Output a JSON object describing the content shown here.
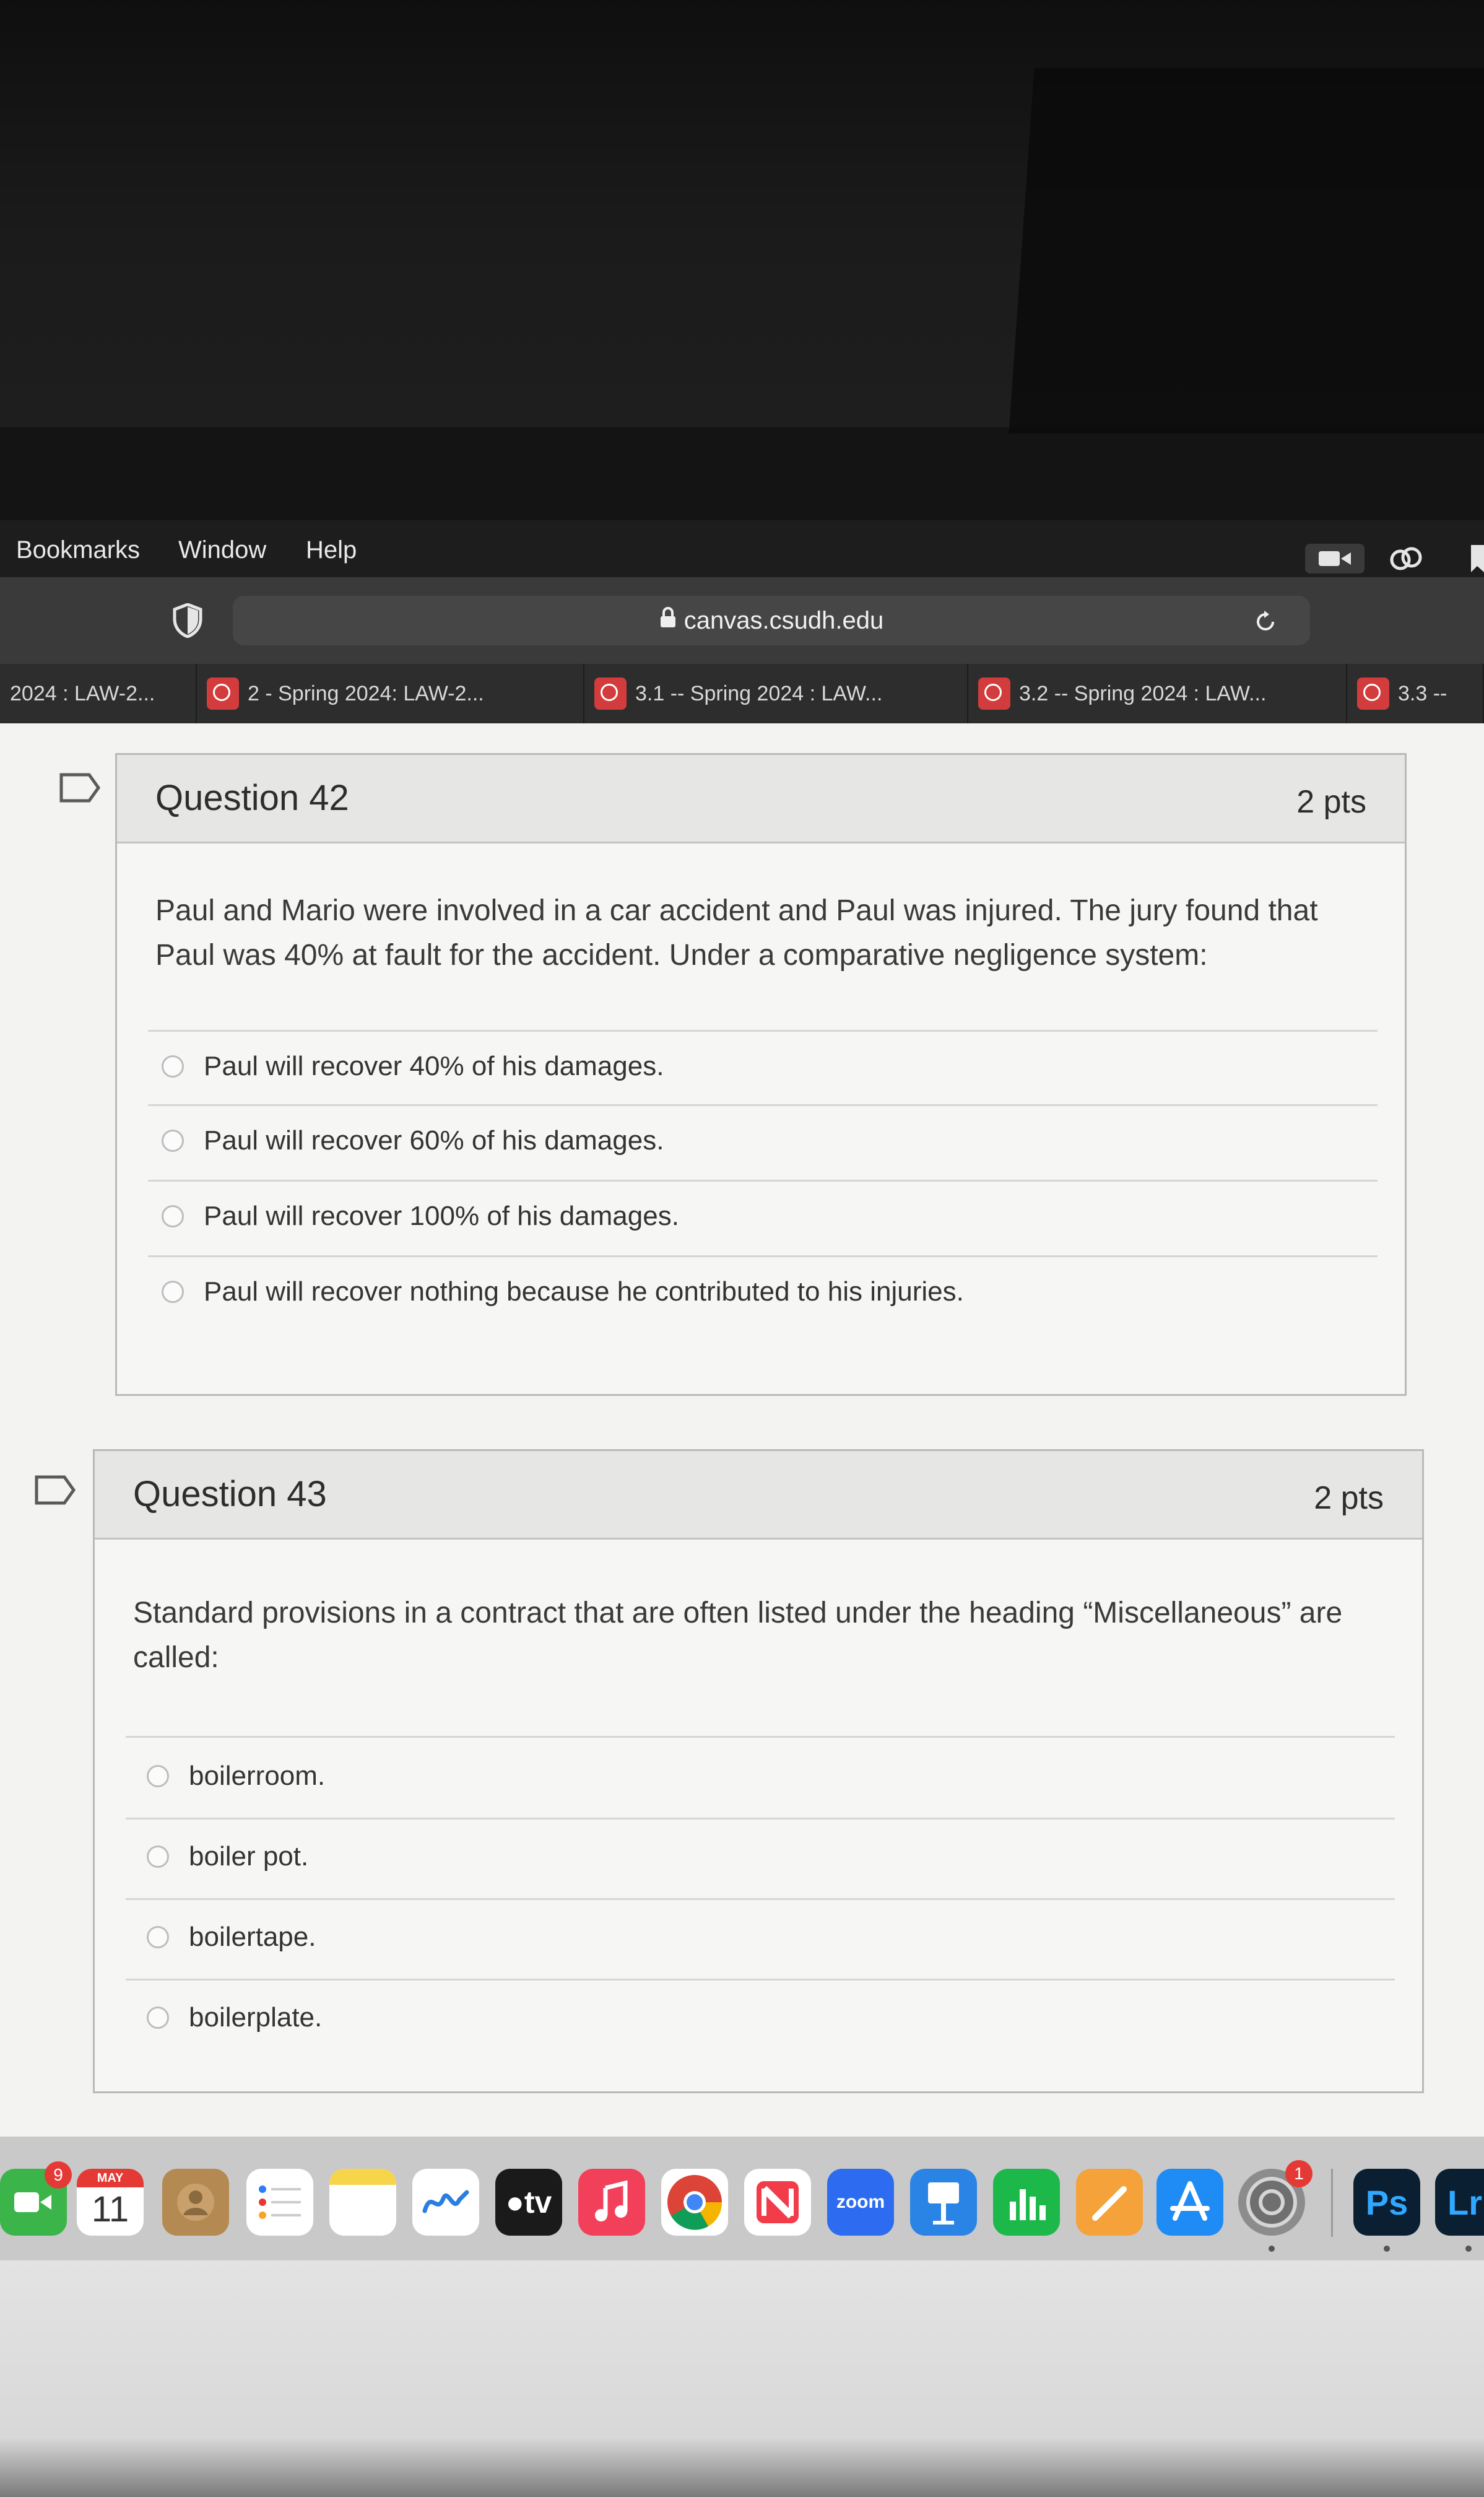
{
  "menubar": {
    "items": [
      "Bookmarks",
      "Window",
      "Help"
    ]
  },
  "toolbar": {
    "url": "canvas.csudh.edu"
  },
  "tabs": [
    {
      "label": "2024 : LAW-2..."
    },
    {
      "label": "2 - Spring 2024: LAW-2..."
    },
    {
      "label": "3.1 -- Spring 2024 : LAW..."
    },
    {
      "label": "3.2 -- Spring 2024 : LAW..."
    },
    {
      "label": "3.3 --"
    }
  ],
  "questions": [
    {
      "title": "Question 42",
      "points": "2 pts",
      "text_lines": [
        "Paul and Mario were involved in a car accident and Paul was injured.  The jury found that",
        "Paul was 40% at fault for the accident.  Under a comparative negligence system:"
      ],
      "answers": [
        "Paul will recover 40% of his damages.",
        "Paul will recover 60% of his damages.",
        "Paul will recover 100% of his damages.",
        "Paul will recover nothing because he contributed to his injuries."
      ]
    },
    {
      "title": "Question 43",
      "points": "2 pts",
      "text_lines": [
        "Standard provisions in a contract that are often listed under the heading “Miscellaneous” are",
        "called:"
      ],
      "answers": [
        "boilerroom.",
        "boiler pot.",
        "boilertape.",
        "boilerplate."
      ]
    }
  ],
  "dock": {
    "facetime_badge": "9",
    "calendar_month": "MAY",
    "calendar_day": "11",
    "appletv_label": "tv",
    "zoom_label": "zoom",
    "settings_badge": "1",
    "photoshop_label": "Ps",
    "lightroom_label": "Lr"
  },
  "colors": {
    "canvas_bg": "#f3f3f2",
    "card_header": "#e6e6e5",
    "tab_favicon": "#d23c3c"
  }
}
